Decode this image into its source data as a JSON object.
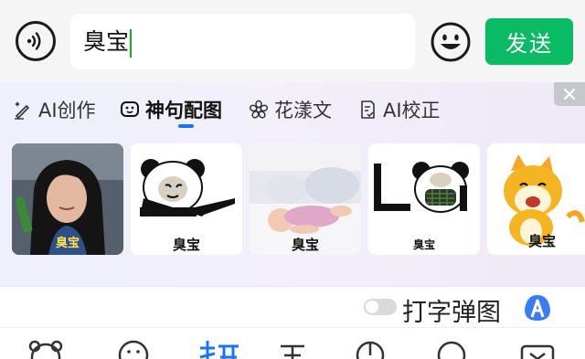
{
  "input": {
    "voice_icon": "voice-waves-icon",
    "text_value": "臭宝",
    "emoji_icon": "smiley-icon",
    "send_label": "发送",
    "accent_color": "#09bb63"
  },
  "panel": {
    "close_icon": "close-icon",
    "tabs": [
      {
        "label": "AI创作",
        "icon": "pen-sparkle-icon"
      },
      {
        "label": "神句配图",
        "icon": "face-bubble-icon",
        "active": true
      },
      {
        "label": "花漾文",
        "icon": "flower-icon"
      },
      {
        "label": "AI校正",
        "icon": "doc-check-icon"
      }
    ],
    "active_color": "#1777f2",
    "cards": [
      {
        "caption": "臭宝",
        "kind": "photo-girl"
      },
      {
        "caption": "臭宝",
        "kind": "panda-meme-point"
      },
      {
        "caption": "臭宝",
        "kind": "photo-baby"
      },
      {
        "caption": "臭宝",
        "kind": "panda-meme-mask"
      },
      {
        "caption": "臭宝",
        "kind": "shiba-cartoon"
      }
    ]
  },
  "bottom": {
    "toggle_on": false,
    "toggle_label": "打字弹图",
    "brand_icon": "baidu-input-logo",
    "toolbar": [
      {
        "icon": "bear-icon"
      },
      {
        "icon": "smiley-icon"
      },
      {
        "icon": "pinyin-icon"
      },
      {
        "icon": "wubi-icon"
      },
      {
        "icon": "cursor-icon"
      },
      {
        "icon": "search-icon"
      },
      {
        "icon": "keyboard-collapse-icon"
      }
    ]
  }
}
